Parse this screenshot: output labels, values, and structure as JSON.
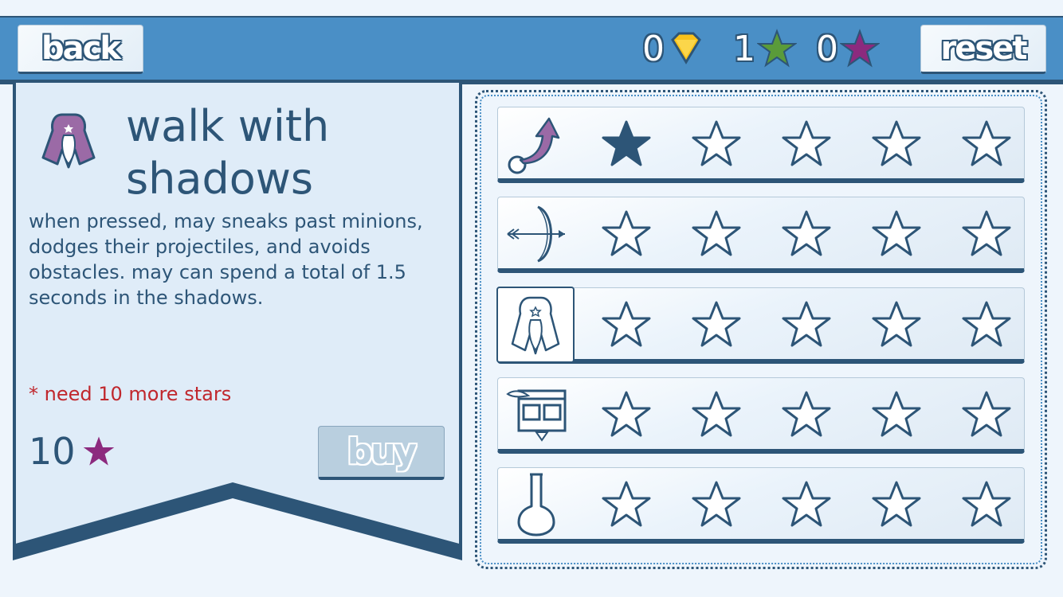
{
  "header": {
    "back_label": "back",
    "reset_label": "reset",
    "currencies": [
      {
        "name": "gems",
        "value": "0",
        "icon": "gem-icon",
        "color": "#f8c21a"
      },
      {
        "name": "green-stars",
        "value": "1",
        "icon": "star-icon",
        "color": "#5a9b3a"
      },
      {
        "name": "purple-stars",
        "value": "0",
        "icon": "star-icon",
        "color": "#8c2a7e"
      }
    ]
  },
  "detail": {
    "icon": "cloak-icon",
    "title": "walk with shadows",
    "description": "when pressed, may sneaks past minions, dodges their projectiles, and avoids obstacles. may can spend a total of 1.5 seconds in the shadows.",
    "requirement": "* need 10 more stars",
    "price": "10",
    "price_icon": "star-icon",
    "buy_label": "buy"
  },
  "skills": [
    {
      "icon": "jump-arrow-icon",
      "filled_stars": 1,
      "total_stars": 5,
      "selected": false
    },
    {
      "icon": "bow-icon",
      "filled_stars": 0,
      "total_stars": 5,
      "selected": false
    },
    {
      "icon": "cloak-icon",
      "filled_stars": 0,
      "total_stars": 5,
      "selected": true
    },
    {
      "icon": "building-icon",
      "filled_stars": 0,
      "total_stars": 5,
      "selected": false
    },
    {
      "icon": "potion-flask-icon",
      "filled_stars": 0,
      "total_stars": 5,
      "selected": false
    }
  ],
  "colors": {
    "dark_navy": "#2d5577",
    "bar_blue": "#4a8fc6",
    "warning_red": "#c0272d",
    "purple": "#8c2a7e"
  }
}
